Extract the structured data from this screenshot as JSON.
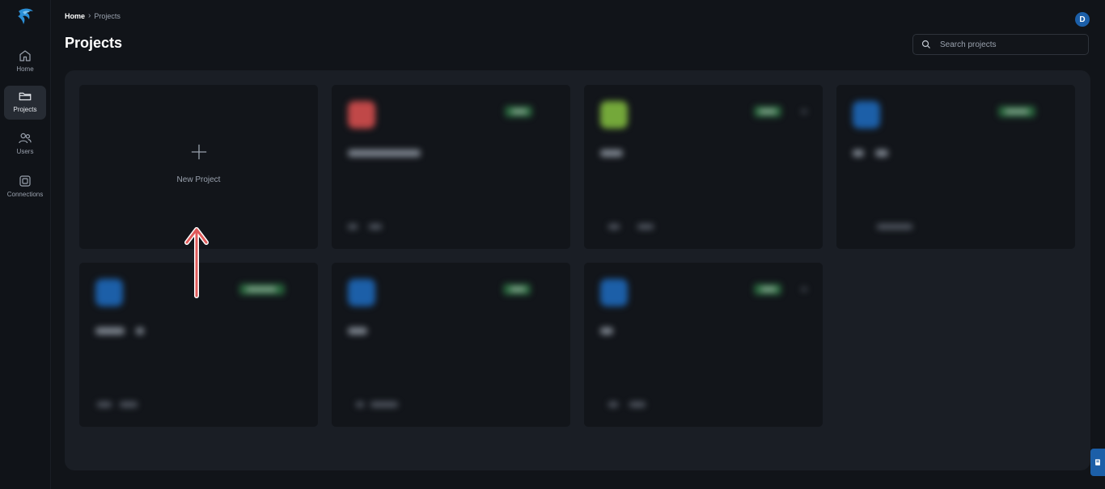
{
  "sidebar": {
    "items": [
      {
        "label": "Home",
        "icon": "home-icon"
      },
      {
        "label": "Projects",
        "icon": "folder-icon",
        "active": true
      },
      {
        "label": "Users",
        "icon": "users-icon"
      },
      {
        "label": "Connections",
        "icon": "connections-icon"
      }
    ]
  },
  "breadcrumb": {
    "home": "Home",
    "current": "Projects"
  },
  "page_title": "Projects",
  "user": {
    "initial": "D"
  },
  "search": {
    "placeholder": "Search projects"
  },
  "new_project": {
    "label": "New Project"
  },
  "colors": {
    "accent": "#1c5fa8",
    "badge_green": "#2f8a4a",
    "annotation_arrow": "#e05a5a"
  }
}
